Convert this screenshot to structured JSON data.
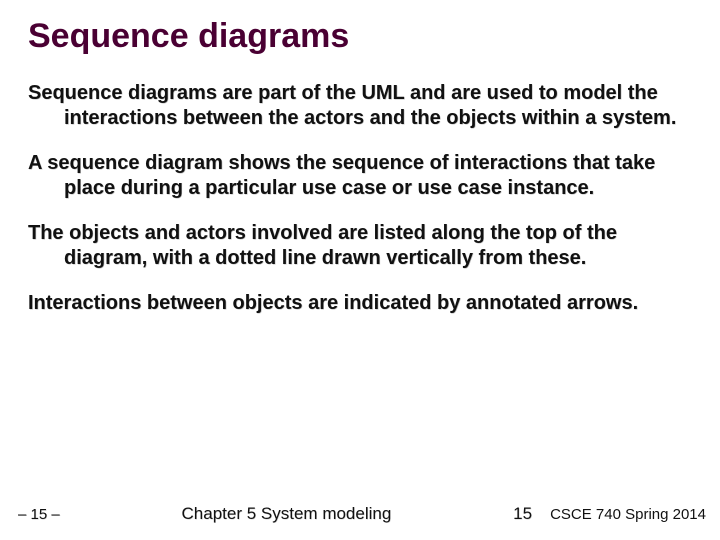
{
  "slide": {
    "title": "Sequence diagrams",
    "paragraphs": [
      "Sequence diagrams are part of the UML and are used to model the interactions between the actors and the objects within a system.",
      "A sequence diagram shows the sequence of interactions that take place during a particular use case or use case instance.",
      "The objects and actors involved are listed along the top of the diagram, with a dotted line drawn vertically from these.",
      "Interactions between objects are indicated by annotated arrows."
    ]
  },
  "footer": {
    "page_marker": "– 15 –",
    "chapter": "Chapter 5 System modeling",
    "page_number": "15",
    "course": "CSCE 740 Spring  2014"
  }
}
